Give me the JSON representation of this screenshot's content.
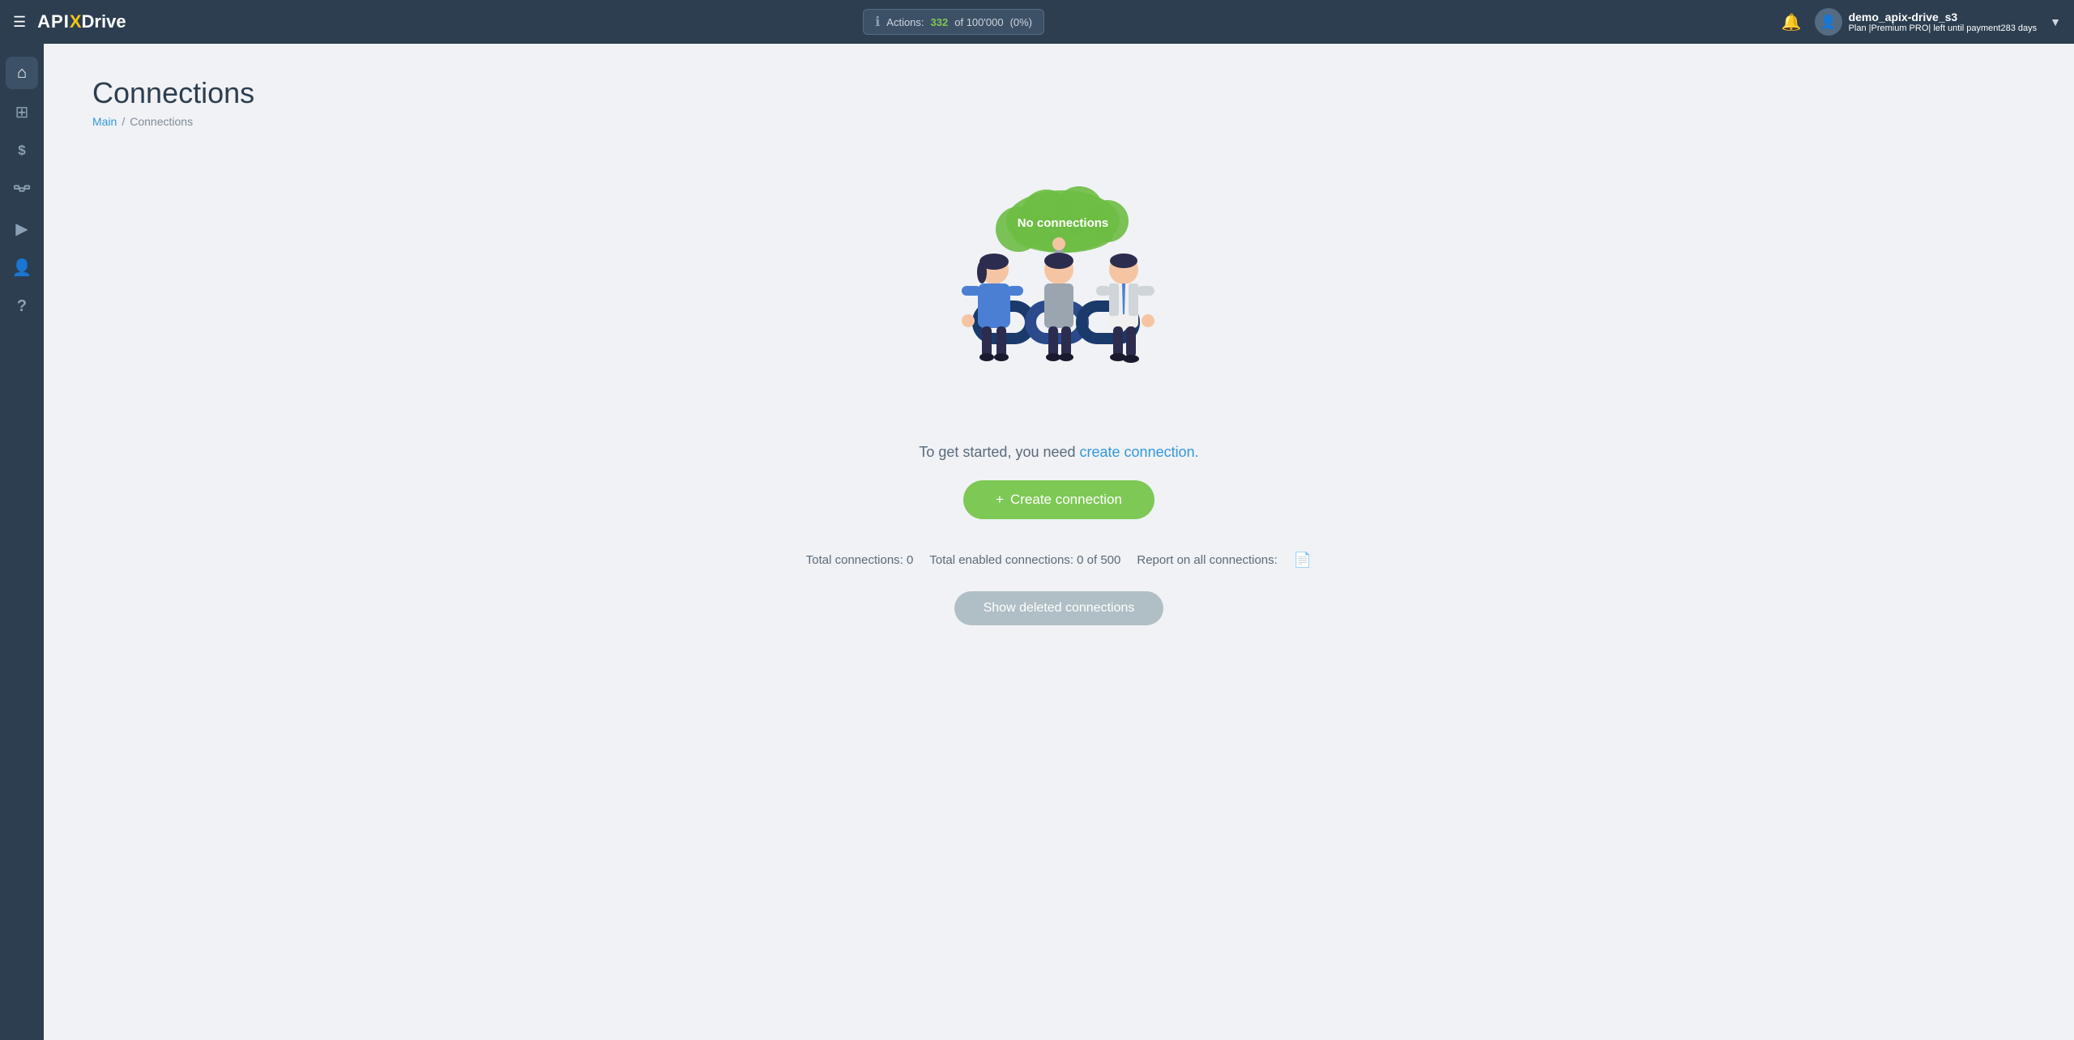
{
  "header": {
    "menu_icon": "☰",
    "logo": {
      "api": "API",
      "x": "X",
      "drive": "Drive"
    },
    "actions": {
      "label": "Actions:",
      "count": "332",
      "separator": " of ",
      "total": "100'000",
      "pct": " (0%)"
    },
    "bell_icon": "🔔",
    "user": {
      "name": "demo_apix-drive_s3",
      "plan_prefix": "Plan |",
      "plan_name": "Premium PRO",
      "plan_suffix": "| left until payment",
      "days": "283 days"
    },
    "dropdown_arrow": "▼"
  },
  "sidebar": {
    "items": [
      {
        "icon": "⌂",
        "name": "home"
      },
      {
        "icon": "⊞",
        "name": "grid"
      },
      {
        "icon": "$",
        "name": "billing"
      },
      {
        "icon": "💼",
        "name": "connections"
      },
      {
        "icon": "▶",
        "name": "youtube"
      },
      {
        "icon": "👤",
        "name": "profile"
      },
      {
        "icon": "?",
        "name": "help"
      }
    ]
  },
  "page": {
    "title": "Connections",
    "breadcrumb": {
      "main": "Main",
      "separator": "/",
      "current": "Connections"
    }
  },
  "illustration": {
    "cloud_text": "No connections"
  },
  "content": {
    "cta_text_prefix": "To get started, you need ",
    "cta_link": "create connection.",
    "create_button_icon": "+",
    "create_button_label": "Create connection",
    "stats": {
      "total_connections": "Total connections: 0",
      "total_enabled": "Total enabled connections: 0 of 500",
      "report_label": "Report on all connections:"
    },
    "show_deleted_label": "Show deleted connections"
  }
}
